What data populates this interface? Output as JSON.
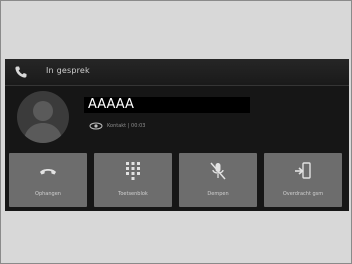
{
  "header": {
    "title": "In gesprek",
    "icon": "phone-icon"
  },
  "caller": {
    "name": "AAAAA",
    "source": "Kontakt",
    "duration": "00:03",
    "avatar_icon": "person-icon",
    "link_icon": "bluetooth-link-icon"
  },
  "buttons": [
    {
      "label": "Ophangen",
      "icon": "hang-up-icon"
    },
    {
      "label": "Toetsenblok",
      "icon": "keypad-icon"
    },
    {
      "label": "Dempen",
      "icon": "mute-icon"
    },
    {
      "label": "Overdracht gsm",
      "icon": "transfer-to-phone-icon"
    }
  ],
  "colors": {
    "screen_bg": "#161616",
    "button_bg": "#6d6d6d",
    "text_light": "#cfcfcf"
  }
}
